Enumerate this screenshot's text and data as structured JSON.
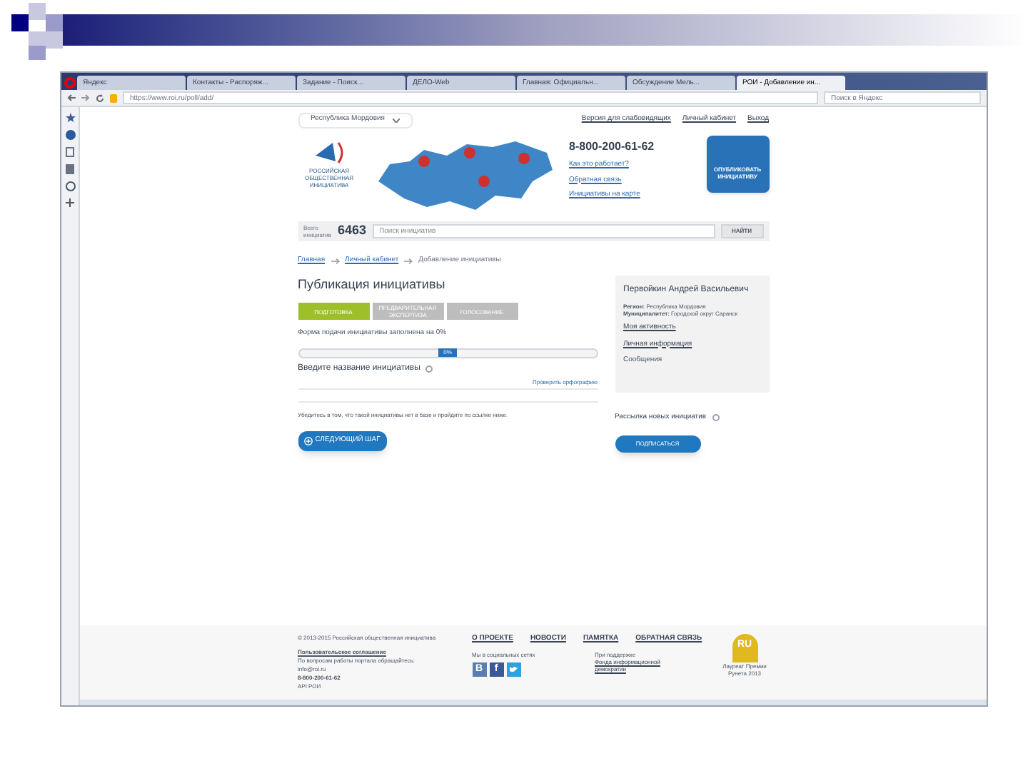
{
  "browser": {
    "tabs": [
      {
        "label": "Яндекс",
        "selected": false
      },
      {
        "label": "Контакты - Распоряж...",
        "selected": false
      },
      {
        "label": "Задание - Поиск...",
        "selected": false
      },
      {
        "label": "ДЕЛО-Web",
        "selected": false
      },
      {
        "label": "Главная: Официальн...",
        "selected": false
      },
      {
        "label": "Обсуждение Мель...",
        "selected": false
      },
      {
        "label": "РОИ - Добавление ин...",
        "selected": true
      }
    ],
    "url": "https://www.roi.ru/poll/add/",
    "search_placeholder": "Поиск в Яндекс"
  },
  "header": {
    "region": "Республика Мордовия",
    "links": [
      "Версия для слабовидящих",
      "Личный кабинет"
    ],
    "logout": "Выход",
    "logo_text": "РОССИЙСКАЯ ОБЩЕСТВЕННАЯ ИНИЦИАТИВА",
    "phone": "8-800-200-61-62",
    "info_links": [
      "Как это работает?",
      "Обратная связь",
      "Инициативы на карте"
    ],
    "publish_button": "ОПУБЛИКОВАТЬ ИНИЦИАТИВУ"
  },
  "search": {
    "count_label": "Всего инициатив",
    "count": "6463",
    "placeholder": "Поиск инициатив",
    "button": "НАЙТИ"
  },
  "breadcrumbs": [
    "Главная",
    "Личный кабинет",
    "Добавление инициативы"
  ],
  "form": {
    "title": "Публикация инициативы",
    "steps": [
      {
        "label": "ПОДГОТОВКА",
        "selected": true
      },
      {
        "label": "ПРЕДВАРИТЕЛЬНАЯ ЭКСПЕРТИЗА",
        "selected": false
      },
      {
        "label": "ГОЛОСОВАНИЕ",
        "selected": false
      }
    ],
    "progress_caption": "Форма подачи инициативы заполнена на 0%",
    "progress": {
      "level": 0,
      "reading": "0%"
    },
    "name_label": "Введите название инициативы",
    "spellcheck": "Проверить орфографию",
    "note": "Убедитесь в том, что такой инициативы нет в базе и пройдите по ссылке ниже.",
    "next_button": "СЛЕДУЮЩИЙ ШАГ"
  },
  "profile": {
    "name": "Первойкин Андрей Васильевич",
    "region_label": "Регион:",
    "region": "Республика Мордовия",
    "municipality_label": "Муниципалитет:",
    "municipality": "Городской округ Саранск",
    "links": [
      {
        "label": "Моя активность",
        "kind": "link"
      },
      {
        "label": "Личная информация",
        "kind": "link"
      },
      {
        "label": "Сообщения",
        "kind": "plain"
      }
    ]
  },
  "subscribe": {
    "label": "Рассылка новых инициатив",
    "button": "ПОДПИСАТЬСЯ"
  },
  "footer": {
    "copyright": "© 2013-2015 Российская общественная инициатива",
    "agreement": "Пользовательское соглашение",
    "contact": "По вопросам работы портала обращайтесь:",
    "email": "info@roi.ru",
    "phone": "8-800-200-61-62",
    "api": "API РОИ",
    "nav": [
      "О ПРОЕКТЕ",
      "НОВОСТИ",
      "ПАМЯТКА",
      "ОБРАТНАЯ СВЯЗЬ"
    ],
    "social_label": "Мы в социальных сетях",
    "social": [
      "В",
      "f"
    ],
    "support_label": "При поддержке",
    "support_link": "Фонда информационной демократии",
    "award_logo": "RU",
    "award": "Лауреат Премии Рунета 2013"
  }
}
